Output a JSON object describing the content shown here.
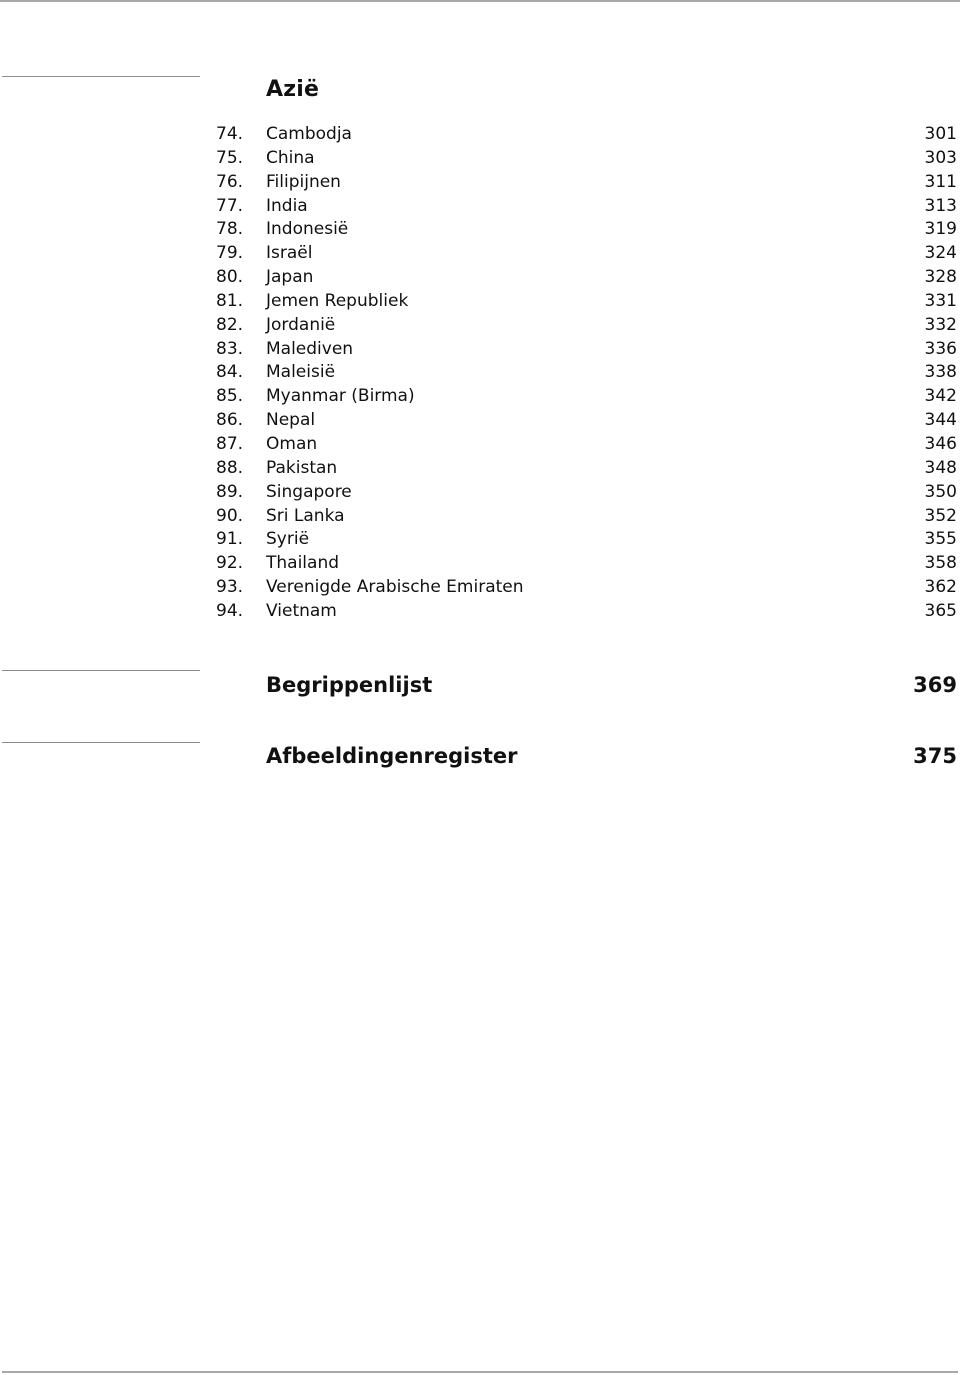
{
  "section": {
    "title": "Azië",
    "entries": [
      {
        "num": "74.",
        "label": "Cambodja",
        "page": "301"
      },
      {
        "num": "75.",
        "label": "China",
        "page": "303"
      },
      {
        "num": "76.",
        "label": "Filipijnen",
        "page": "311"
      },
      {
        "num": "77.",
        "label": "India",
        "page": "313"
      },
      {
        "num": "78.",
        "label": "Indonesië",
        "page": "319"
      },
      {
        "num": "79.",
        "label": "Israël",
        "page": "324"
      },
      {
        "num": "80.",
        "label": "Japan",
        "page": "328"
      },
      {
        "num": "81.",
        "label": "Jemen Republiek",
        "page": "331"
      },
      {
        "num": "82.",
        "label": "Jordanië",
        "page": "332"
      },
      {
        "num": "83.",
        "label": "Malediven",
        "page": "336"
      },
      {
        "num": "84.",
        "label": "Maleisië",
        "page": "338"
      },
      {
        "num": "85.",
        "label": "Myanmar (Birma)",
        "page": "342"
      },
      {
        "num": "86.",
        "label": "Nepal",
        "page": "344"
      },
      {
        "num": "87.",
        "label": "Oman",
        "page": "346"
      },
      {
        "num": "88.",
        "label": "Pakistan",
        "page": "348"
      },
      {
        "num": "89.",
        "label": "Singapore",
        "page": "350"
      },
      {
        "num": "90.",
        "label": "Sri Lanka",
        "page": "352"
      },
      {
        "num": "91.",
        "label": "Syrië",
        "page": "355"
      },
      {
        "num": "92.",
        "label": "Thailand",
        "page": "358"
      },
      {
        "num": "93.",
        "label": "Verenigde Arabische Emiraten",
        "page": "362"
      },
      {
        "num": "94.",
        "label": "Vietnam",
        "page": "365"
      }
    ]
  },
  "appendices": [
    {
      "label": "Begrippenlijst",
      "page": "369"
    },
    {
      "label": "Afbeeldingenregister",
      "page": "375"
    }
  ]
}
